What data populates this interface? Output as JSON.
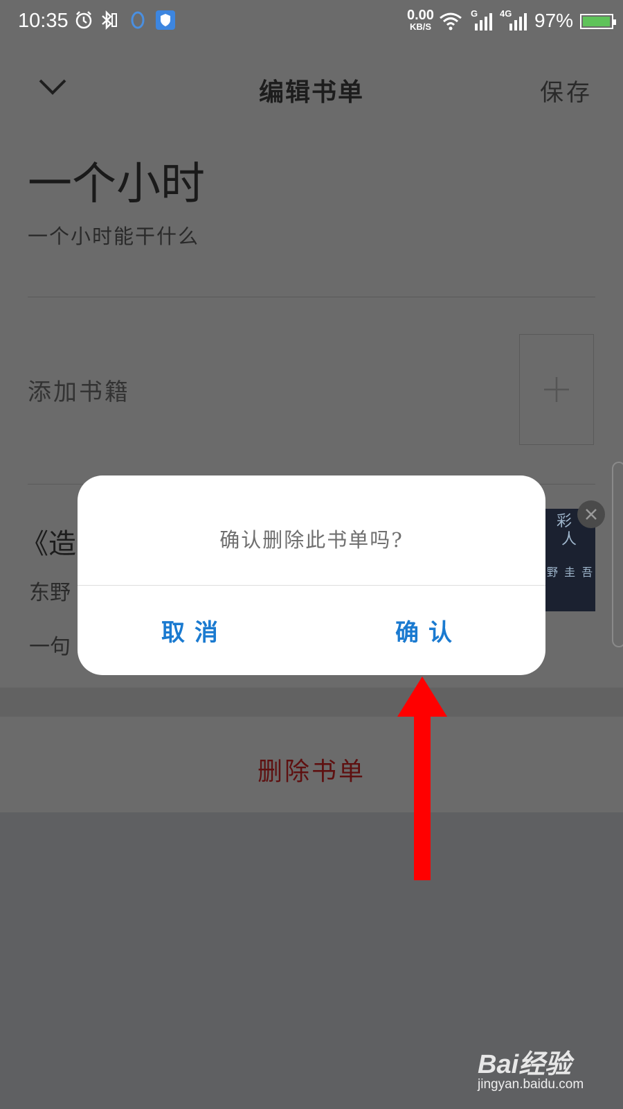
{
  "status_bar": {
    "time": "10:35",
    "net_speed_value": "0.00",
    "net_speed_unit": "KB/S",
    "signal1_label": "G",
    "signal2_label": "4G",
    "battery_percent": "97%",
    "battery_level": 0.97
  },
  "header": {
    "title": "编辑书单",
    "save_label": "保存"
  },
  "book_list": {
    "name": "一个小时",
    "description": "一个小时能干什么"
  },
  "add_books": {
    "label": "添加书籍"
  },
  "book_item": {
    "title": "《造",
    "author": "东野",
    "note": "一句",
    "cover_title": "彩  人",
    "cover_author": "野 圭 吾"
  },
  "delete_list": {
    "label": "删除书单"
  },
  "dialog": {
    "message": "确认删除此书单吗?",
    "cancel_label": "取消",
    "confirm_label": "确认"
  },
  "watermark": {
    "brand": "Bai经验",
    "url": "jingyan.baidu.com"
  },
  "colors": {
    "overlay": "#6b6b6b",
    "dialog_button": "#1a7ad0",
    "delete_text": "#5e1010",
    "arrow": "#ff0000"
  }
}
